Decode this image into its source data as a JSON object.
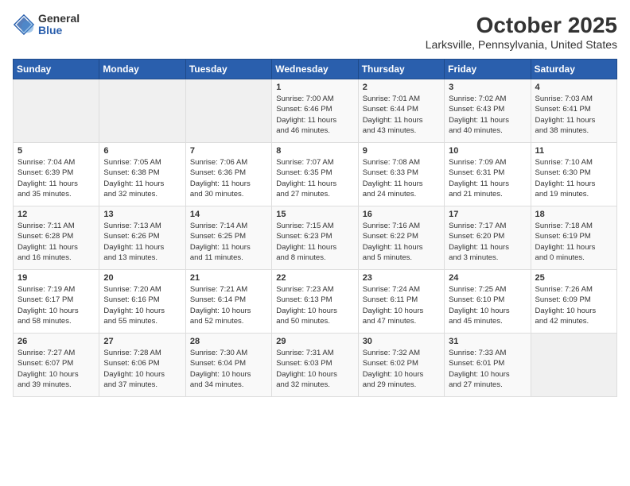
{
  "logo": {
    "general": "General",
    "blue": "Blue"
  },
  "title": "October 2025",
  "subtitle": "Larksville, Pennsylvania, United States",
  "days_of_week": [
    "Sunday",
    "Monday",
    "Tuesday",
    "Wednesday",
    "Thursday",
    "Friday",
    "Saturday"
  ],
  "weeks": [
    [
      {
        "day": "",
        "content": ""
      },
      {
        "day": "",
        "content": ""
      },
      {
        "day": "",
        "content": ""
      },
      {
        "day": "1",
        "content": "Sunrise: 7:00 AM\nSunset: 6:46 PM\nDaylight: 11 hours\nand 46 minutes."
      },
      {
        "day": "2",
        "content": "Sunrise: 7:01 AM\nSunset: 6:44 PM\nDaylight: 11 hours\nand 43 minutes."
      },
      {
        "day": "3",
        "content": "Sunrise: 7:02 AM\nSunset: 6:43 PM\nDaylight: 11 hours\nand 40 minutes."
      },
      {
        "day": "4",
        "content": "Sunrise: 7:03 AM\nSunset: 6:41 PM\nDaylight: 11 hours\nand 38 minutes."
      }
    ],
    [
      {
        "day": "5",
        "content": "Sunrise: 7:04 AM\nSunset: 6:39 PM\nDaylight: 11 hours\nand 35 minutes."
      },
      {
        "day": "6",
        "content": "Sunrise: 7:05 AM\nSunset: 6:38 PM\nDaylight: 11 hours\nand 32 minutes."
      },
      {
        "day": "7",
        "content": "Sunrise: 7:06 AM\nSunset: 6:36 PM\nDaylight: 11 hours\nand 30 minutes."
      },
      {
        "day": "8",
        "content": "Sunrise: 7:07 AM\nSunset: 6:35 PM\nDaylight: 11 hours\nand 27 minutes."
      },
      {
        "day": "9",
        "content": "Sunrise: 7:08 AM\nSunset: 6:33 PM\nDaylight: 11 hours\nand 24 minutes."
      },
      {
        "day": "10",
        "content": "Sunrise: 7:09 AM\nSunset: 6:31 PM\nDaylight: 11 hours\nand 21 minutes."
      },
      {
        "day": "11",
        "content": "Sunrise: 7:10 AM\nSunset: 6:30 PM\nDaylight: 11 hours\nand 19 minutes."
      }
    ],
    [
      {
        "day": "12",
        "content": "Sunrise: 7:11 AM\nSunset: 6:28 PM\nDaylight: 11 hours\nand 16 minutes."
      },
      {
        "day": "13",
        "content": "Sunrise: 7:13 AM\nSunset: 6:26 PM\nDaylight: 11 hours\nand 13 minutes."
      },
      {
        "day": "14",
        "content": "Sunrise: 7:14 AM\nSunset: 6:25 PM\nDaylight: 11 hours\nand 11 minutes."
      },
      {
        "day": "15",
        "content": "Sunrise: 7:15 AM\nSunset: 6:23 PM\nDaylight: 11 hours\nand 8 minutes."
      },
      {
        "day": "16",
        "content": "Sunrise: 7:16 AM\nSunset: 6:22 PM\nDaylight: 11 hours\nand 5 minutes."
      },
      {
        "day": "17",
        "content": "Sunrise: 7:17 AM\nSunset: 6:20 PM\nDaylight: 11 hours\nand 3 minutes."
      },
      {
        "day": "18",
        "content": "Sunrise: 7:18 AM\nSunset: 6:19 PM\nDaylight: 11 hours\nand 0 minutes."
      }
    ],
    [
      {
        "day": "19",
        "content": "Sunrise: 7:19 AM\nSunset: 6:17 PM\nDaylight: 10 hours\nand 58 minutes."
      },
      {
        "day": "20",
        "content": "Sunrise: 7:20 AM\nSunset: 6:16 PM\nDaylight: 10 hours\nand 55 minutes."
      },
      {
        "day": "21",
        "content": "Sunrise: 7:21 AM\nSunset: 6:14 PM\nDaylight: 10 hours\nand 52 minutes."
      },
      {
        "day": "22",
        "content": "Sunrise: 7:23 AM\nSunset: 6:13 PM\nDaylight: 10 hours\nand 50 minutes."
      },
      {
        "day": "23",
        "content": "Sunrise: 7:24 AM\nSunset: 6:11 PM\nDaylight: 10 hours\nand 47 minutes."
      },
      {
        "day": "24",
        "content": "Sunrise: 7:25 AM\nSunset: 6:10 PM\nDaylight: 10 hours\nand 45 minutes."
      },
      {
        "day": "25",
        "content": "Sunrise: 7:26 AM\nSunset: 6:09 PM\nDaylight: 10 hours\nand 42 minutes."
      }
    ],
    [
      {
        "day": "26",
        "content": "Sunrise: 7:27 AM\nSunset: 6:07 PM\nDaylight: 10 hours\nand 39 minutes."
      },
      {
        "day": "27",
        "content": "Sunrise: 7:28 AM\nSunset: 6:06 PM\nDaylight: 10 hours\nand 37 minutes."
      },
      {
        "day": "28",
        "content": "Sunrise: 7:30 AM\nSunset: 6:04 PM\nDaylight: 10 hours\nand 34 minutes."
      },
      {
        "day": "29",
        "content": "Sunrise: 7:31 AM\nSunset: 6:03 PM\nDaylight: 10 hours\nand 32 minutes."
      },
      {
        "day": "30",
        "content": "Sunrise: 7:32 AM\nSunset: 6:02 PM\nDaylight: 10 hours\nand 29 minutes."
      },
      {
        "day": "31",
        "content": "Sunrise: 7:33 AM\nSunset: 6:01 PM\nDaylight: 10 hours\nand 27 minutes."
      },
      {
        "day": "",
        "content": ""
      }
    ]
  ]
}
